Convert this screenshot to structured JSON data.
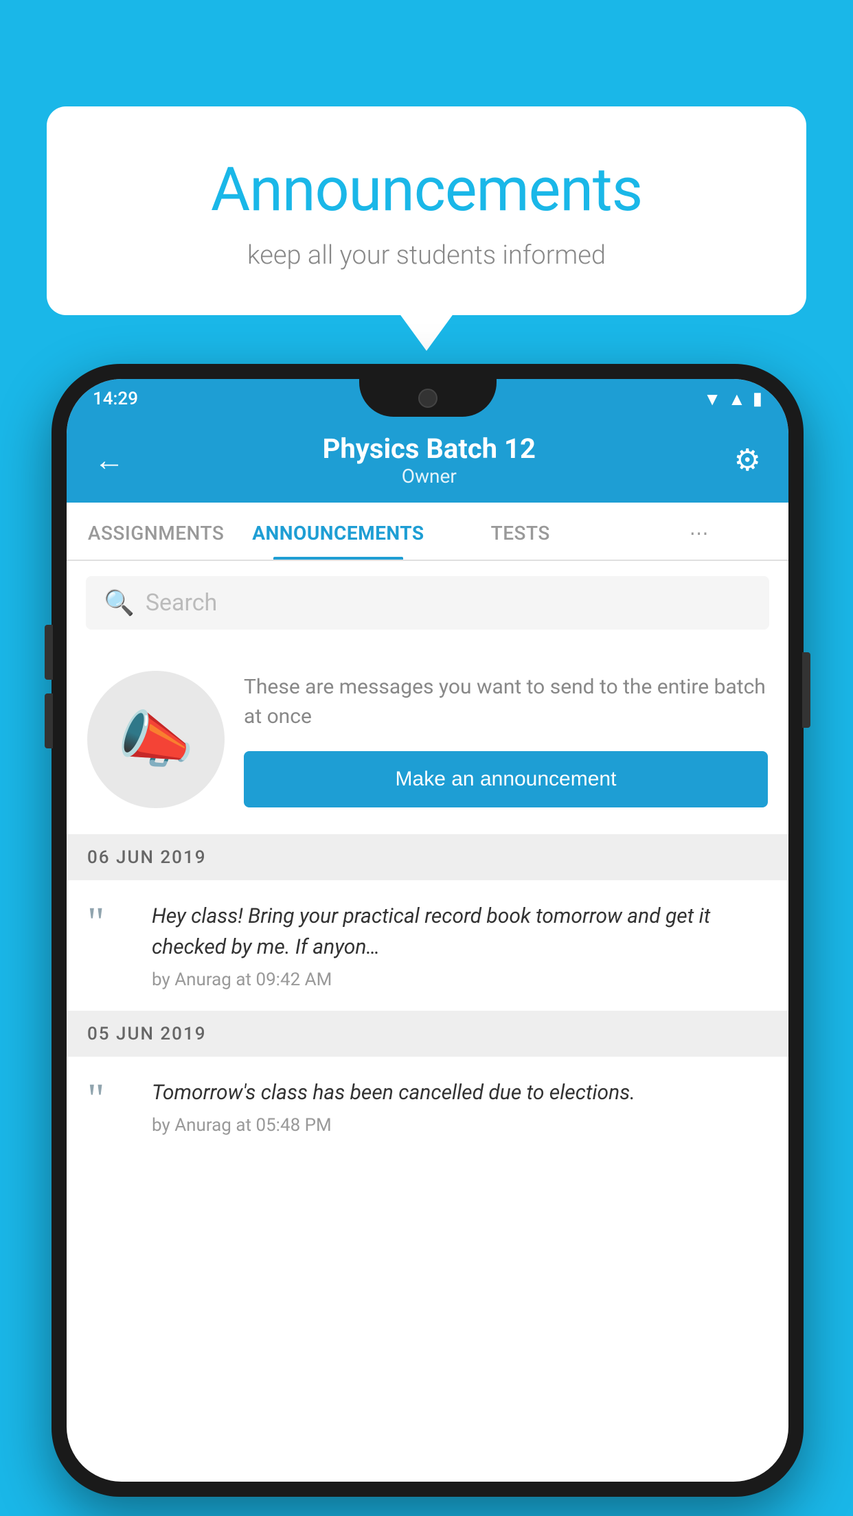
{
  "background_color": "#1ab7e8",
  "speech_bubble": {
    "title": "Announcements",
    "subtitle": "keep all your students informed"
  },
  "phone": {
    "status_bar": {
      "time": "14:29",
      "icons": [
        "wifi",
        "signal",
        "battery"
      ]
    },
    "header": {
      "title": "Physics Batch 12",
      "subtitle": "Owner",
      "back_label": "←",
      "settings_label": "⚙"
    },
    "tabs": [
      {
        "label": "ASSIGNMENTS",
        "active": false
      },
      {
        "label": "ANNOUNCEMENTS",
        "active": true
      },
      {
        "label": "TESTS",
        "active": false
      },
      {
        "label": "⋯",
        "active": false
      }
    ],
    "search": {
      "placeholder": "Search"
    },
    "announcement_cta": {
      "description": "These are messages you want to send to the entire batch at once",
      "button_label": "Make an announcement"
    },
    "announcements": [
      {
        "date": "06  JUN  2019",
        "text": "Hey class! Bring your practical record book tomorrow and get it checked by me. If anyon…",
        "meta": "by Anurag at 09:42 AM"
      },
      {
        "date": "05  JUN  2019",
        "text": "Tomorrow's class has been cancelled due to elections.",
        "meta": "by Anurag at 05:48 PM"
      }
    ]
  }
}
